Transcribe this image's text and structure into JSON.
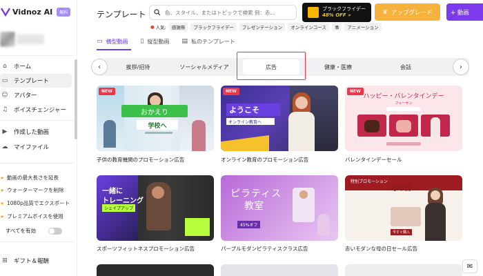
{
  "app": {
    "name": "Vidnoz AI",
    "badge": "無料"
  },
  "sidebar": {
    "items": [
      {
        "label": "ホーム",
        "icon": "home-icon"
      },
      {
        "label": "テンプレート",
        "icon": "template-icon"
      },
      {
        "label": "アバター",
        "icon": "avatar-icon"
      },
      {
        "label": "ボイスチェンジャー",
        "icon": "voice-changer-icon"
      },
      {
        "label": "作成した動画",
        "icon": "video-icon"
      },
      {
        "label": "マイファイル",
        "icon": "cloud-icon"
      }
    ],
    "features": [
      "動画の最大長さを延長",
      "ウォーターマークを削除",
      "1080p品質でエクスポート",
      "プレミアムボイスを使用"
    ],
    "toggle_label": "すべてを有効",
    "gift_label": "ギフト＆報酬"
  },
  "header": {
    "title": "テンプレート",
    "search_placeholder": "色、スタイル、またはトピックで検索 例：赤…",
    "black_friday_line1": "ブラックフライデー",
    "black_friday_line2": "48% OFF »",
    "upgrade_label": "アップグレード",
    "create_label": "+ 動画"
  },
  "popular": {
    "label": "人気:",
    "tags": [
      "感謝祭",
      "ブラックフライデー",
      "プレゼンテーション",
      "オンラインコース",
      "事",
      "アニメーション"
    ]
  },
  "tabs": [
    {
      "label": "横型動画",
      "icon": "landscape-icon"
    },
    {
      "label": "縦型動画",
      "icon": "portrait-icon"
    },
    {
      "label": "私のテンプレート",
      "icon": "folder-icon"
    }
  ],
  "categories": [
    "挨拶/招待",
    "ソーシャルメディア",
    "広告",
    "健康・医療",
    "会話"
  ],
  "cards": [
    {
      "caption": "子供の教育機関のプロモーション広告",
      "new": "NEW",
      "t1": "おかえり",
      "t2": "学校へ"
    },
    {
      "caption": "オンライン教育のプロモーション広告",
      "new": "NEW",
      "t1": "ようこそ",
      "t2": "オンライン教育へ"
    },
    {
      "caption": "バレンタインデーセール",
      "new": "NEW",
      "t1": "ハッピー・バレンタインデー",
      "t2": "フェーサン"
    },
    {
      "caption": "スポーツフィットネスプロモーション広告",
      "t1": "一緒に",
      "t2": "トレーニング",
      "t3": "シェイプアップ"
    },
    {
      "caption": "パープルモダンピラティスクラス広告",
      "t1": "ピラティス",
      "t2": "教室",
      "t3": "45%オフ"
    },
    {
      "caption": "赤いモダンな母の日セール広告",
      "t1": "特別プロモーション",
      "t2": "母の日",
      "t3": "今すぐ購入"
    }
  ],
  "colors": {
    "accent": "#6b3fe3",
    "upgrade": "#f6b23d",
    "new_badge": "#e8394b",
    "highlight": "#e63a4a"
  }
}
